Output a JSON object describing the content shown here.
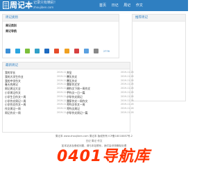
{
  "header": {
    "logo": "周记本",
    "slogan": "记录只有精彩!",
    "domain": "zhoujiben.com",
    "nav": [
      "首页",
      "日记",
      "周记",
      "作文"
    ]
  },
  "categories": {
    "title": "周记类别",
    "items": [
      "周记类别",
      "周记导航"
    ],
    "more": "2776"
  },
  "side": {
    "title": "推荐周记"
  },
  "recent": {
    "title": "最新周记",
    "rows": [
      [
        "我的学长",
        "2019-11-28",
        "大全",
        "2019-11-28"
      ],
      [
        "我的大学生作业",
        "2019-11-28",
        "寒天作文",
        "2019-11-28"
      ],
      [
        "我的中学作文",
        "2019-11-28",
        "寒天作文",
        "2019-11-28"
      ],
      [
        "春天的周记",
        "2019-11-28",
        "我家作文学",
        "2019-11-28"
      ],
      [
        "周记周记大全",
        "2019-11-28",
        "周作文下周一周作文",
        "2019-11-28"
      ],
      [
        "小学周记作文",
        "2019-11-28",
        "手作文一日一篇",
        "2019-11-28"
      ],
      [
        "小学生日作文一周",
        "2019-11-28",
        "小学作文周记",
        "2019-11-28"
      ],
      [
        "小学作文周记一周",
        "2019-11-28",
        "我家作文一周作文",
        "2019-11-28"
      ],
      [
        "小学作文作文一周",
        "2019-11-28",
        "写作文作文一周",
        "2019-11-28"
      ],
      [
        "作文周记一周",
        "2019-11-28",
        "写作文周记",
        "2019-11-28"
      ],
      [
        "周记作文一周",
        "2019-11-28",
        "小学作文周记一篇",
        "2019-11-28"
      ]
    ]
  },
  "footer": {
    "line1": "周记本 www.zhoujiben.com 周记本 版权所有 ICP备18018087号-2",
    "line2": "日记 周记 作文",
    "line3": "如本站涉及侵权问题，请与本站联系，我们会尽快删除处理"
  },
  "watermark": "0401导航库",
  "colors": {
    "header": "#2f7fc1",
    "watermark": "#ff3300"
  }
}
